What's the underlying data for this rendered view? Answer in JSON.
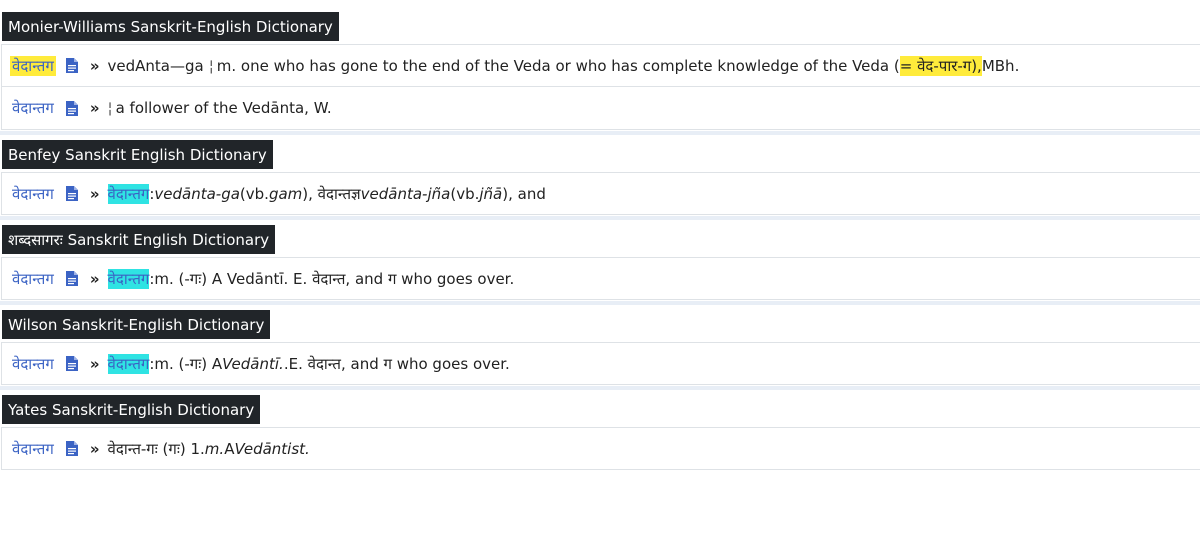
{
  "sections": [
    {
      "title": "Monier-Williams Sanskrit-English Dictionary",
      "entries": [
        {
          "headword": "वेदान्तग",
          "text_a": "vedAnta—ga",
          "sep": "¦",
          "text_b": "m. one who has gone to the end of the Veda or who has complete knowledge of the Veda (",
          "hl": "= वेद-पार-ग),",
          "text_c": " MBh."
        },
        {
          "headword": "वेदान्तग",
          "sep": "¦",
          "text_b": "a follower of the Vedānta, W."
        }
      ]
    },
    {
      "title": "Benfey Sanskrit English Dictionary",
      "entries": [
        {
          "headword": "वेदान्तग",
          "hl": "वेदान्तग",
          "colon": ":",
          "t1": " vedānta-ga",
          "t2": " (vb. ",
          "t3": "gam",
          "t4": "), वेदान्तज्ञ ",
          "t5": "vedānta-jña",
          "t6": " (vb. ",
          "t7": "jñā",
          "t8": "), and"
        }
      ]
    },
    {
      "title": "शब्दसागरः Sanskrit English Dictionary",
      "entries": [
        {
          "headword": "वेदान्तग",
          "hl": "वेदान्तग",
          "colon": ":",
          "t1": " m. (-गः) A Vedāntī. E. वेदान्त, and ग who goes over."
        }
      ]
    },
    {
      "title": "Wilson Sanskrit-English Dictionary",
      "entries": [
        {
          "headword": "वेदान्तग",
          "hl": "वेदान्तग",
          "colon": ":",
          "t1": " m. (-गः) A ",
          "t2": "Vedāntī.",
          "t3": " .E. वेदान्त, and ग who goes over."
        }
      ]
    },
    {
      "title": "Yates Sanskrit-English Dictionary",
      "entries": [
        {
          "headword": "वेदान्तग",
          "t1": "वेदान्त-गः (गः) 1. ",
          "t2": "m.",
          "t3": " A ",
          "t4": "Vedāntist."
        }
      ]
    }
  ],
  "icons": {
    "doc": "document-icon",
    "chevron": "»"
  },
  "colors": {
    "headword": "#3b63c4",
    "title_bg": "#212529",
    "highlight_yellow": "#ffeb3b",
    "highlight_cyan": "#2fe3e3"
  }
}
